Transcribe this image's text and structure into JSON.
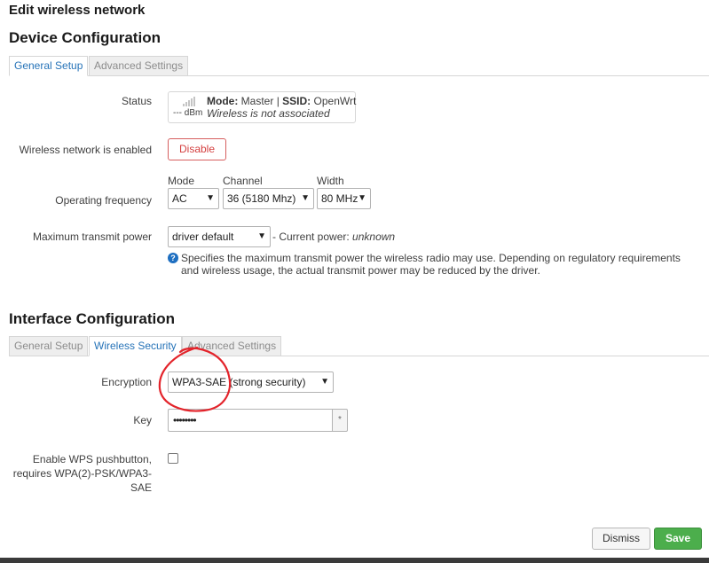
{
  "page_title": "Edit wireless network",
  "device": {
    "title": "Device Configuration",
    "tabs": [
      {
        "label": "General Setup",
        "active": true
      },
      {
        "label": "Advanced Settings",
        "active": false
      }
    ],
    "status_label": "Status",
    "status": {
      "dbm": "--- dBm",
      "mode_key": "Mode:",
      "mode_val": "Master",
      "sep": "|",
      "ssid_key": "SSID:",
      "ssid_val": "OpenWrt",
      "message": "Wireless is not associated",
      "icon": "signal-strength-icon"
    },
    "enabled_label": "Wireless network is enabled",
    "disable_button": "Disable",
    "frequency": {
      "label": "Operating frequency",
      "mode_label": "Mode",
      "mode_value": "AC",
      "channel_label": "Channel",
      "channel_value": "36 (5180 Mhz)",
      "width_label": "Width",
      "width_value": "80 MHz"
    },
    "power": {
      "label": "Maximum transmit power",
      "value": "driver default",
      "current_prefix": "- Current power:",
      "current_value": "unknown",
      "help_icon": "help-icon",
      "help_text": "Specifies the maximum transmit power the wireless radio may use. Depending on regulatory requirements and wireless usage, the actual transmit power may be reduced by the driver."
    }
  },
  "interface": {
    "title": "Interface Configuration",
    "tabs": [
      {
        "label": "General Setup",
        "active": false
      },
      {
        "label": "Wireless Security",
        "active": true
      },
      {
        "label": "Advanced Settings",
        "active": false
      }
    ],
    "encryption_label": "Encryption",
    "encryption_value": "WPA3-SAE (strong security)",
    "key_label": "Key",
    "key_value": "••••••••",
    "key_reveal": "*",
    "wps_label": "Enable WPS pushbutton, requires WPA(2)-PSK/WPA3-SAE",
    "wps_checked": false
  },
  "footer": {
    "dismiss": "Dismiss",
    "save": "Save"
  },
  "colors": {
    "accent": "#2673b8",
    "danger": "#d43f3f",
    "save_green": "#4cae4c",
    "annotation_red": "#e3242b"
  }
}
